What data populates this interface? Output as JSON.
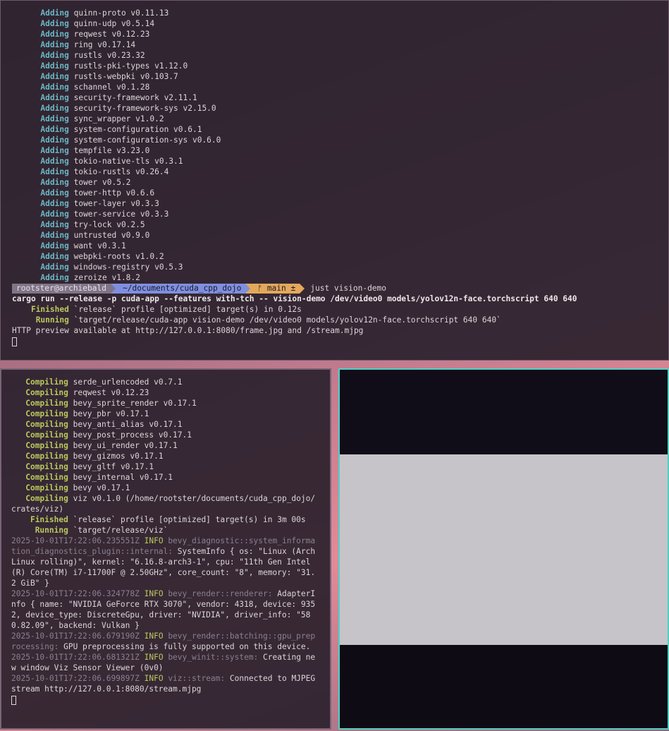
{
  "top_terminal": {
    "adding_label": "Adding",
    "adding_lines": [
      "quinn-proto v0.11.13",
      "quinn-udp v0.5.14",
      "reqwest v0.12.23",
      "ring v0.17.14",
      "rustls v0.23.32",
      "rustls-pki-types v1.12.0",
      "rustls-webpki v0.103.7",
      "schannel v0.1.28",
      "security-framework v2.11.1",
      "security-framework-sys v2.15.0",
      "sync_wrapper v1.0.2",
      "system-configuration v0.6.1",
      "system-configuration-sys v0.6.0",
      "tempfile v3.23.0",
      "tokio-native-tls v0.3.1",
      "tokio-rustls v0.26.4",
      "tower v0.5.2",
      "tower-http v0.6.6",
      "tower-layer v0.3.3",
      "tower-service v0.3.3",
      "try-lock v0.2.5",
      "untrusted v0.9.0",
      "want v0.3.1",
      "webpki-roots v1.0.2",
      "windows-registry v0.5.3",
      "zeroize v1.8.2"
    ],
    "prompt": {
      "user_host": "rootster@archiebald",
      "dir": "~/documents/cuda_cpp_dojo",
      "git": "ᚠ main ±",
      "command": "just vision-demo"
    },
    "cargo_cmd": "cargo run --release -p cuda-app --features with-tch -- vision-demo /dev/video0 models/yolov12n-face.torchscript 640 640",
    "finished_label": "Finished",
    "finished_text": "`release` profile [optimized] target(s) in 0.12s",
    "running_label": "Running",
    "running_text": "`target/release/cuda-app vision-demo /dev/video0 models/yolov12n-face.torchscript 640 640`",
    "http_line": "HTTP preview available at http://127.0.0.1:8080/frame.jpg and /stream.mjpg"
  },
  "bottom_terminal": {
    "compiling_label": "Compiling",
    "compiling_lines": [
      "serde_urlencoded v0.7.1",
      "reqwest v0.12.23",
      "bevy_sprite_render v0.17.1",
      "bevy_pbr v0.17.1",
      "bevy_anti_alias v0.17.1",
      "bevy_post_process v0.17.1",
      "bevy_ui_render v0.17.1",
      "bevy_gizmos v0.17.1",
      "bevy_gltf v0.17.1",
      "bevy_internal v0.17.1",
      "bevy v0.17.1",
      "viz v0.1.0 (/home/rootster/documents/cuda_cpp_dojo/crates/viz)"
    ],
    "finished_label": "Finished",
    "finished_text": "`release` profile [optimized] target(s) in 3m 00s",
    "running_label": "Running",
    "running_text": "`target/release/viz`",
    "logs": [
      {
        "ts": "2025-10-01T17:22:06.235551Z",
        "level": "INFO",
        "module": "bevy_diagnostic::system_information_diagnostics_plugin::internal:",
        "msg": "SystemInfo { os: \"Linux (Arch Linux rolling)\", kernel: \"6.16.8-arch3-1\", cpu: \"11th Gen Intel(R) Core(TM) i7-11700F @ 2.50GHz\", core_count: \"8\", memory: \"31.2 GiB\" }"
      },
      {
        "ts": "2025-10-01T17:22:06.324778Z",
        "level": "INFO",
        "module": "bevy_render::renderer:",
        "msg": "AdapterInfo { name: \"NVIDIA GeForce RTX 3070\", vendor: 4318, device: 9352, device_type: DiscreteGpu, driver: \"NVIDIA\", driver_info: \"580.82.09\", backend: Vulkan }"
      },
      {
        "ts": "2025-10-01T17:22:06.679190Z",
        "level": "INFO",
        "module": "bevy_render::batching::gpu_preprocessing:",
        "msg": "GPU preprocessing is fully supported on this device."
      },
      {
        "ts": "2025-10-01T17:22:06.681321Z",
        "level": "INFO",
        "module": "bevy_winit::system:",
        "msg": "Creating new window Viz Sensor Viewer (0v0)"
      },
      {
        "ts": "2025-10-01T17:22:06.699897Z",
        "level": "INFO",
        "module": "viz::stream:",
        "msg": "Connected to MJPEG stream http://127.0.0.1:8080/stream.mjpg"
      }
    ]
  },
  "colors": {
    "adding": "#6bb7c4",
    "compiling": "#b9c95d",
    "viewer_border": "#4fd1c5"
  }
}
